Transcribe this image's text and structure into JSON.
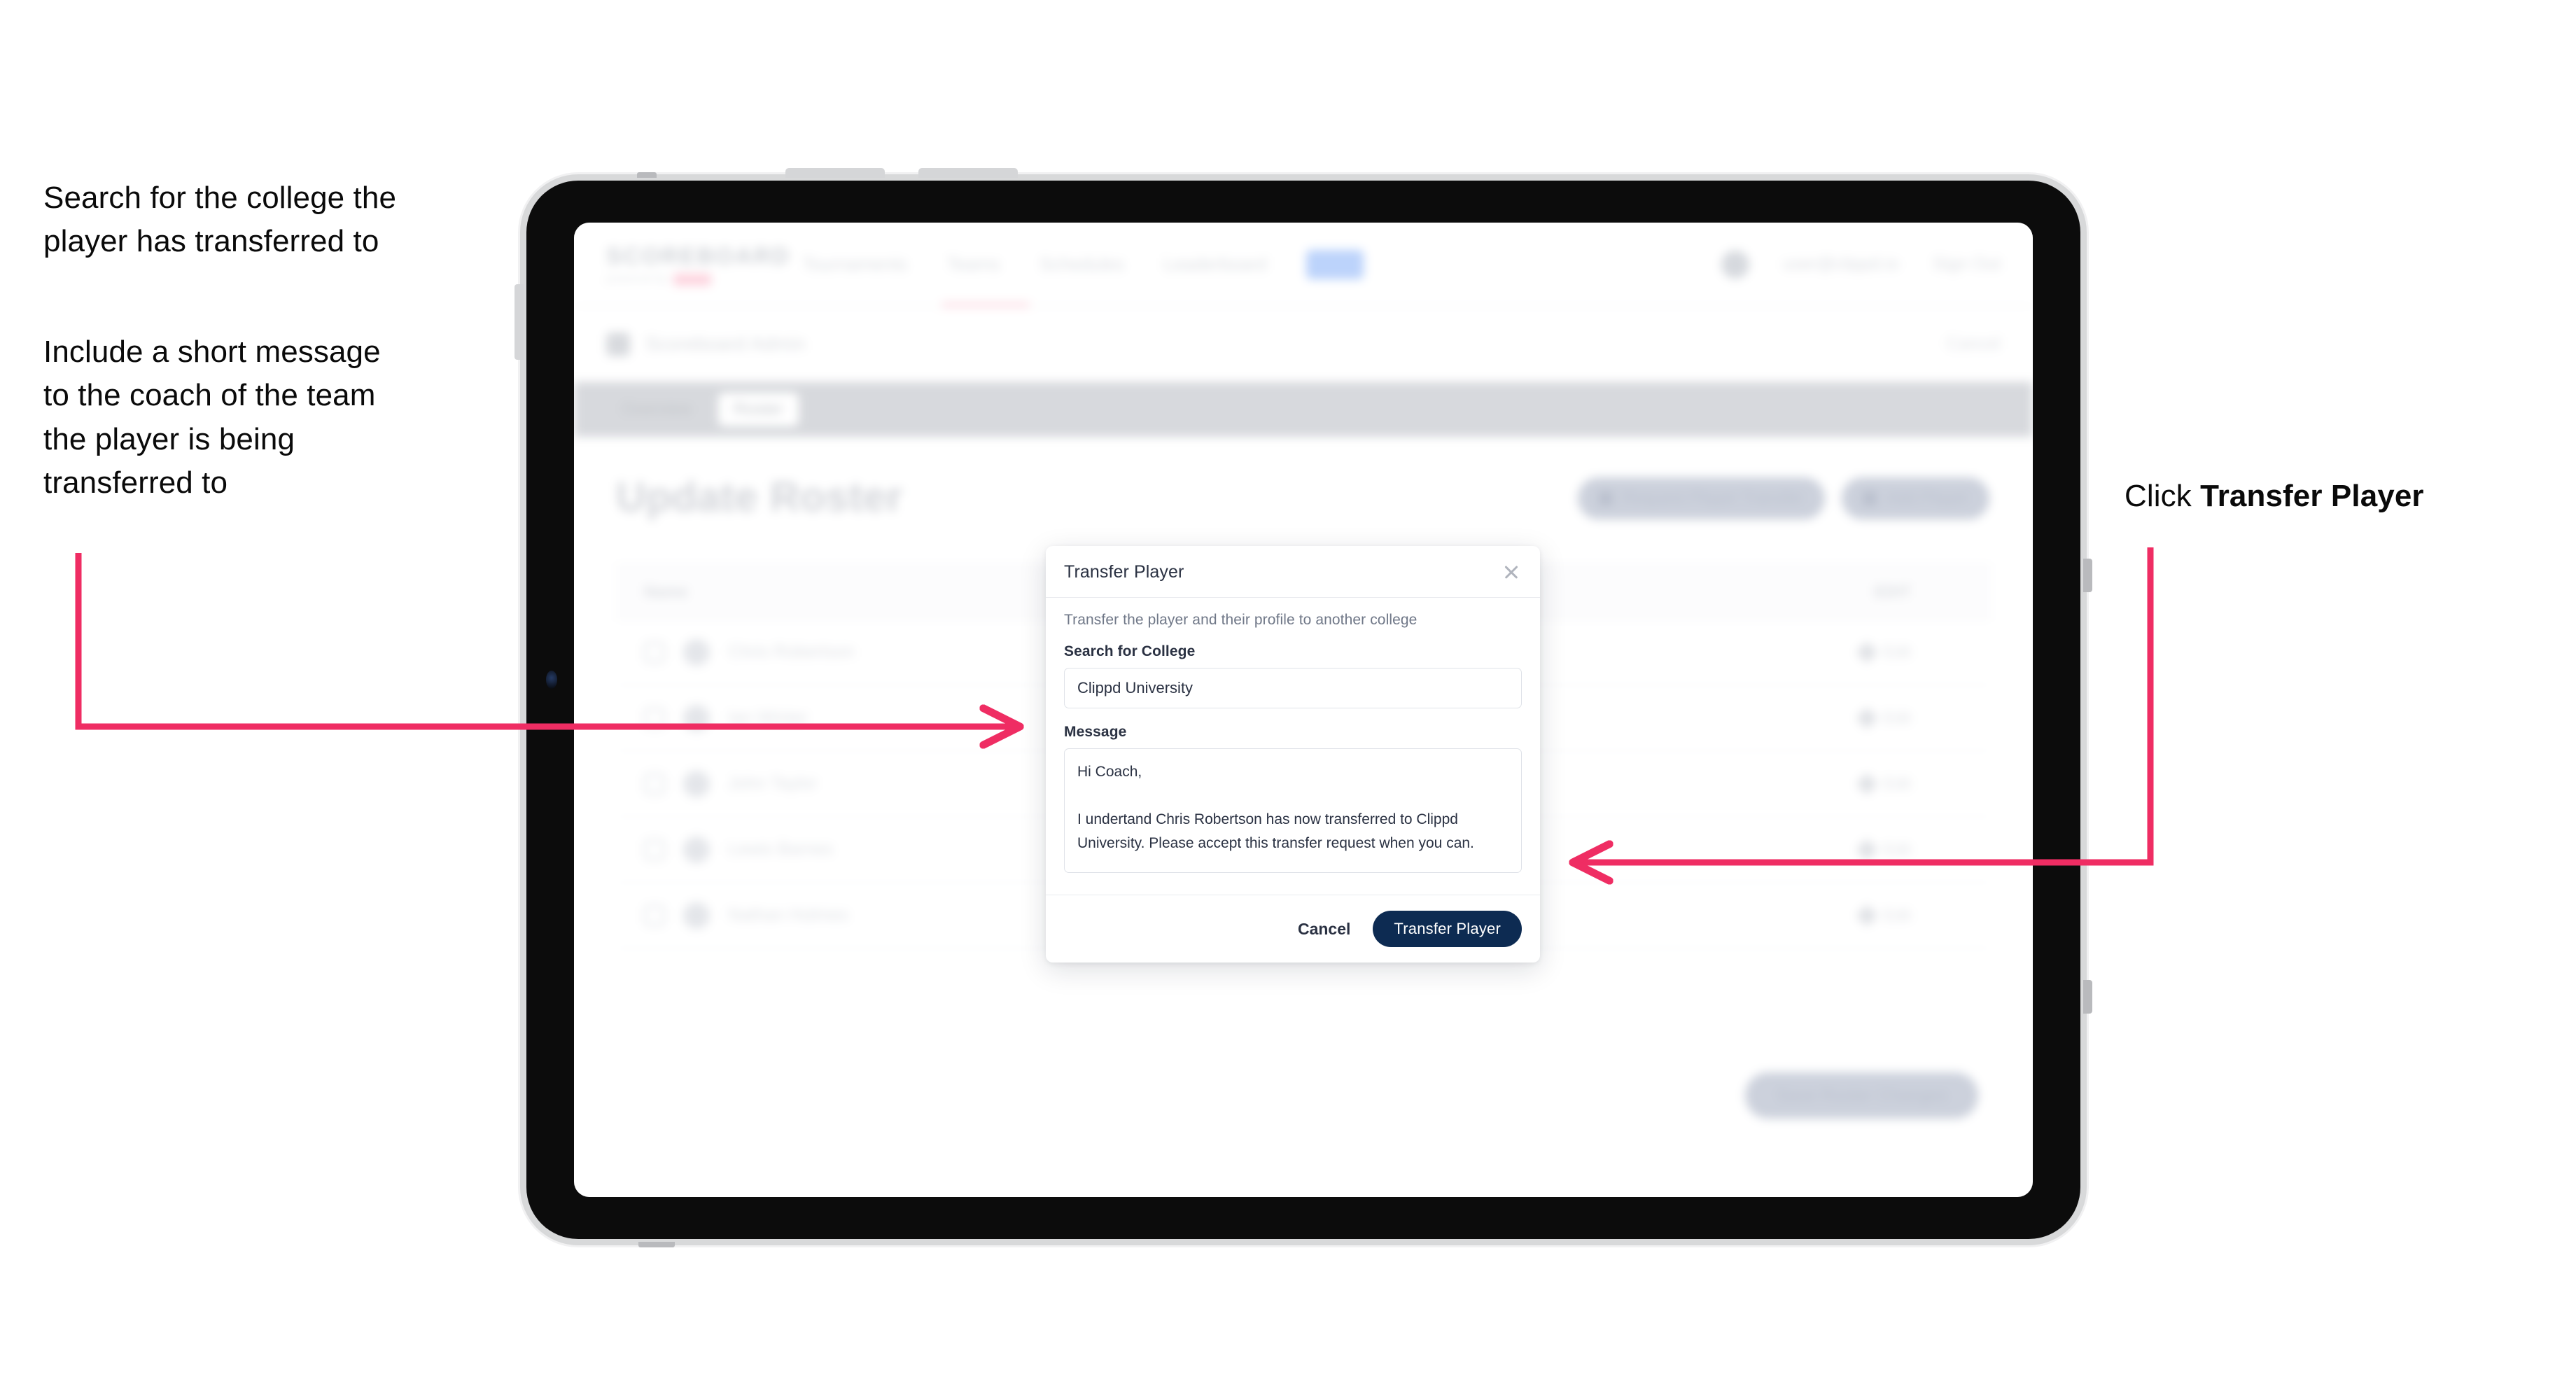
{
  "annotations": {
    "left_1": "Search for the college the\nplayer has transferred to",
    "left_2": "Include a short message\nto the coach of the team\nthe player is being\ntransferred to",
    "right_1_prefix": "Click ",
    "right_1_bold": "Transfer Player",
    "arrow_color": "#ef2d63"
  },
  "app": {
    "logo": {
      "main": "SCOREBOARD",
      "sub": "powered by"
    },
    "nav_links": [
      "Tournaments",
      "Teams",
      "Schedules",
      "Leaderboard"
    ],
    "nav_right": {
      "user": "user@clippd.io",
      "sign_out": "Sign Out"
    },
    "subbar": {
      "title": "Scoreboard Admin",
      "action": "Cancel"
    },
    "tabs": [
      {
        "label": "Overview",
        "active": false
      },
      {
        "label": "Roster",
        "active": true
      }
    ],
    "page_title": "Update Roster",
    "page_actions": [
      {
        "label": "Request Player Transfer"
      },
      {
        "label": "Add Player"
      }
    ],
    "table": {
      "columns": [
        "Name",
        "EDIT"
      ],
      "rows": [
        {
          "name": "Chris Robertson",
          "edit": "Edit"
        },
        {
          "name": "Ian Winter",
          "edit": "Edit"
        },
        {
          "name": "John Taylor",
          "edit": "Edit"
        },
        {
          "name": "Lewis Barnes",
          "edit": "Edit"
        },
        {
          "name": "Nathan Holmes",
          "edit": "Edit"
        }
      ]
    },
    "footer_button": "Save Roster Changes"
  },
  "modal": {
    "title": "Transfer Player",
    "close_icon": "close-icon",
    "subtitle": "Transfer the player and their profile to another college",
    "college_label": "Search for College",
    "college_value": "Clippd University",
    "college_placeholder": "Search for College",
    "message_label": "Message",
    "message_value": "Hi Coach,\n\nI undertand Chris Robertson has now transferred to Clippd University. Please accept this transfer request when you can.",
    "message_placeholder": "Message",
    "cancel_label": "Cancel",
    "submit_label": "Transfer Player",
    "submit_color": "#0d2b52"
  }
}
